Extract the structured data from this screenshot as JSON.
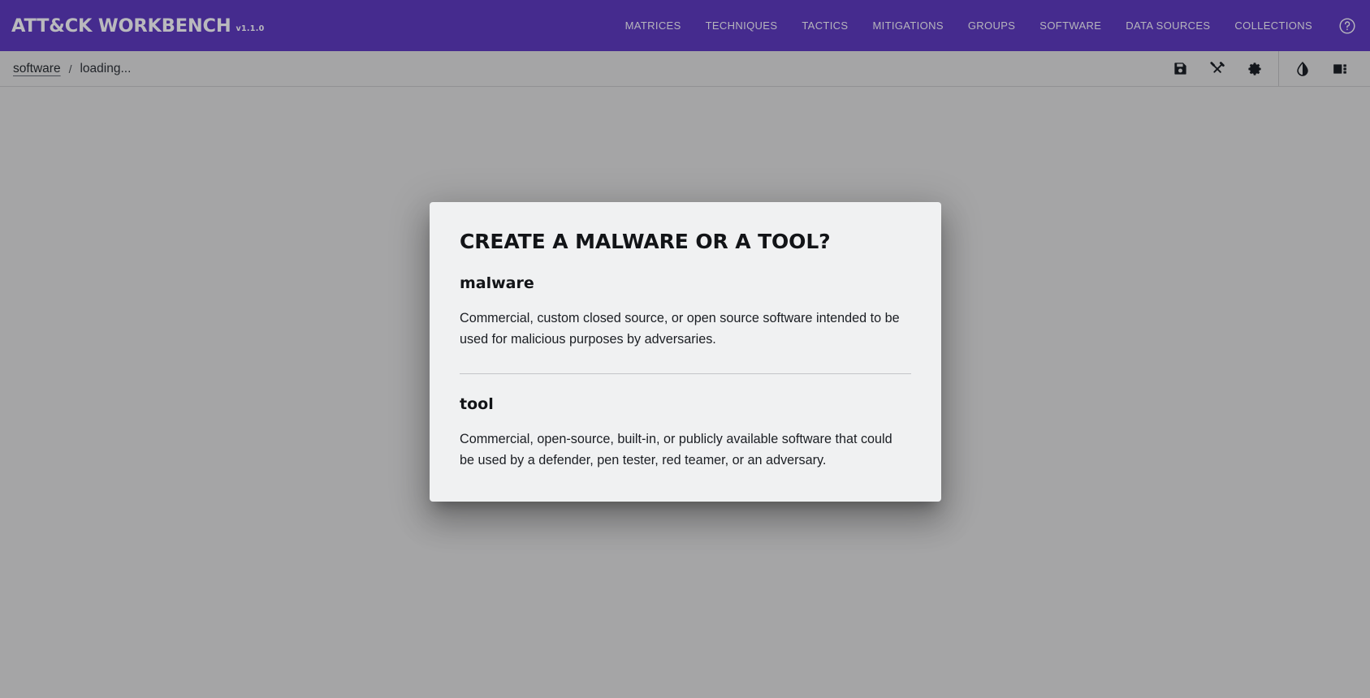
{
  "header": {
    "brand_title": "ATT&CK WORKBENCH",
    "brand_version": "v1.1.0",
    "nav_items": [
      {
        "label": "MATRICES",
        "name": "nav-matrices"
      },
      {
        "label": "TECHNIQUES",
        "name": "nav-techniques"
      },
      {
        "label": "TACTICS",
        "name": "nav-tactics"
      },
      {
        "label": "MITIGATIONS",
        "name": "nav-mitigations"
      },
      {
        "label": "GROUPS",
        "name": "nav-groups"
      },
      {
        "label": "SOFTWARE",
        "name": "nav-software"
      },
      {
        "label": "DATA SOURCES",
        "name": "nav-data-sources"
      },
      {
        "label": "COLLECTIONS",
        "name": "nav-collections"
      }
    ],
    "help_icon": "help-circle-icon",
    "background_color": "#452b8e",
    "text_color": "#b6b5bc"
  },
  "subbar": {
    "breadcrumb": {
      "link_label": "software",
      "separator": "/",
      "current_label": "loading..."
    },
    "toolbar": {
      "left_group": [
        {
          "name": "save-button",
          "icon": "save-floppy-icon",
          "title": "save"
        },
        {
          "name": "fix-tools-button",
          "icon": "crossed-tools-icon",
          "title": "tools"
        },
        {
          "name": "settings-button",
          "icon": "gear-icon",
          "title": "settings"
        }
      ],
      "right_group": [
        {
          "name": "theme-toggle-button",
          "icon": "contrast-droplet-icon",
          "title": "theme"
        },
        {
          "name": "layout-toggle-button",
          "icon": "sidebar-layout-icon",
          "title": "layout"
        }
      ]
    },
    "background_color": "#a5a5a6"
  },
  "content": {
    "spinner": {
      "name": "loading-spinner",
      "color": "#452b8e",
      "visible": true
    },
    "dialog": {
      "title": "CREATE A MALWARE OR A TOOL?",
      "background_color": "#f0f1f2",
      "sections": [
        {
          "heading": "malware",
          "body": "Commercial, custom closed source, or open source software intended to be used for malicious purposes by adversaries."
        },
        {
          "heading": "tool",
          "body": "Commercial, open-source, built-in, or publicly available software that could be used by a defender, pen tester, red teamer, or an adversary."
        }
      ]
    }
  }
}
